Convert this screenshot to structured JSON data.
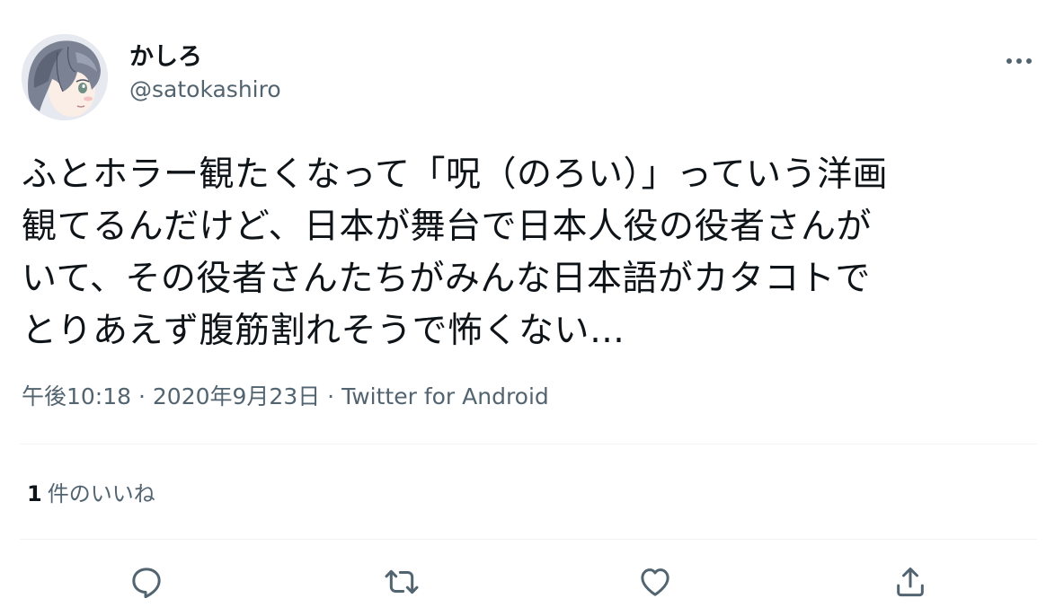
{
  "user": {
    "display_name": "かしろ",
    "handle": "@satokashiro",
    "avatar_icon": "user-avatar-anime-boy"
  },
  "tweet": {
    "text": "ふとホラー観たくなって「呪（のろい）」っていう洋画\n観てるんだけど、日本が舞台で日本人役の役者さんが\nいて、その役者さんたちがみんな日本語がカタコトで\nとりあえず腹筋割れそうで怖くない…",
    "time": "午後10:18",
    "separator": " · ",
    "date": "2020年9月23日",
    "source": "Twitter for Android"
  },
  "stats": {
    "likes_count": "1",
    "likes_label": "件のいいね"
  },
  "actions": {
    "reply_icon": "reply-icon",
    "retweet_icon": "retweet-icon",
    "like_icon": "heart-icon",
    "share_icon": "share-icon",
    "more_icon": "more-dots-icon"
  },
  "colors": {
    "text": "#0f1419",
    "secondary": "#536471",
    "divider": "#eff3f4",
    "icon": "#536471"
  }
}
